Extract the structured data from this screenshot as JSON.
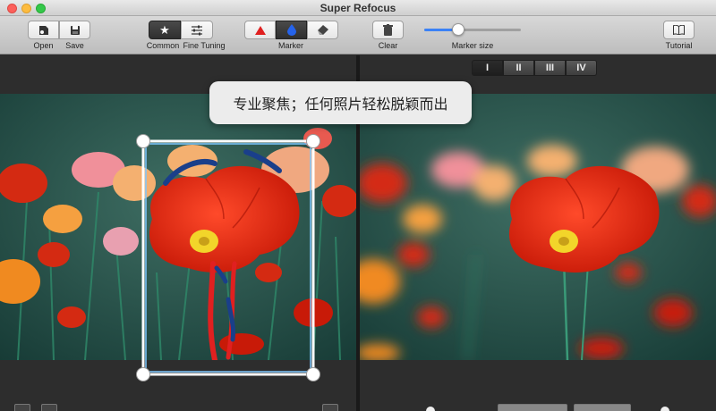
{
  "window": {
    "title": "Super Refocus"
  },
  "toolbar": {
    "open_label": "Open",
    "save_label": "Save",
    "common_label": "Common",
    "fine_tuning_label": "Fine Tuning",
    "marker_label": "Marker",
    "clear_label": "Clear",
    "marker_size_label": "Marker size",
    "marker_size_value": 0.35,
    "tutorial_label": "Tutorial"
  },
  "view_tabs": [
    "I",
    "II",
    "III",
    "IV"
  ],
  "banner": {
    "text": "专业聚焦；任何照片轻松脱颖而出"
  },
  "colors": {
    "accent": "#3b82f6",
    "marker_red": "#e02020",
    "marker_blue": "#1a5fb4"
  }
}
